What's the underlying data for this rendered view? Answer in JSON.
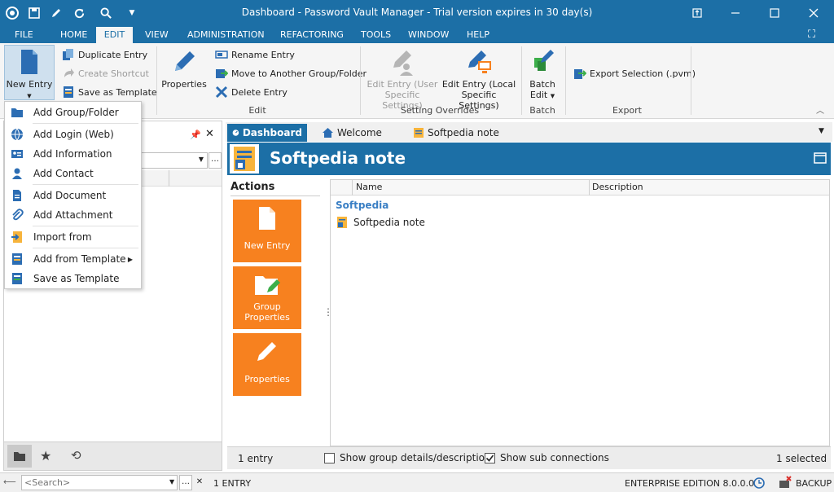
{
  "titlebar": {
    "title": "Dashboard - Password Vault Manager - Trial version expires in 30 day(s)"
  },
  "menu_tabs": [
    "FILE",
    "HOME",
    "EDIT",
    "VIEW",
    "ADMINISTRATION",
    "REFACTORING",
    "TOOLS",
    "WINDOW",
    "HELP"
  ],
  "ribbon": {
    "new_entry": "New Entry",
    "duplicate_entry": "Duplicate Entry",
    "create_shortcut": "Create Shortcut",
    "save_as_template": "Save as Template",
    "properties": "Properties",
    "rename_entry": "Rename Entry",
    "move_to_group": "Move to Another Group/Folder",
    "delete_entry": "Delete Entry",
    "edit_group": "Edit",
    "edit_entry_user_1": "Edit Entry (User",
    "edit_entry_user_2": "Specific Settings)",
    "edit_entry_local_1": "Edit Entry (Local",
    "edit_entry_local_2": "Specific Settings)",
    "setting_overrides_group": "Setting Overrides",
    "batch_edit_1": "Batch",
    "batch_edit_2": "Edit",
    "batch_group": "Batch",
    "export_selection": "Export Selection (.pvm)",
    "export_group": "Export"
  },
  "dropdown": {
    "items": [
      "Add Group/Folder",
      "Add Login (Web)",
      "Add Information",
      "Add Contact",
      "Add Document",
      "Add Attachment",
      "Import from",
      "Add from Template",
      "Save as Template"
    ]
  },
  "doc_tabs": [
    "Dashboard",
    "Welcome",
    "Softpedia note"
  ],
  "header": {
    "title": "Softpedia note"
  },
  "actions": {
    "title": "Actions",
    "new_entry": "New Entry",
    "group_properties_1": "Group",
    "group_properties_2": "Properties",
    "properties": "Properties"
  },
  "grid": {
    "columns": [
      "Name",
      "Description"
    ],
    "group": "Softpedia",
    "rows": [
      {
        "name": "Softpedia note",
        "description": ""
      }
    ]
  },
  "status": {
    "entry_count": "1 entry",
    "show_group_details": "Show group details/description",
    "show_group_details_checked": false,
    "show_sub_connections": "Show sub connections",
    "show_sub_connections_checked": true,
    "selected": "1 selected"
  },
  "bottom": {
    "search_placeholder": "<Search>",
    "entries": "1 ENTRY",
    "edition": "ENTERPRISE EDITION 8.0.0.0",
    "backup": "BACKUP"
  },
  "colors": {
    "accent_blue": "#1c6fa6",
    "tile_orange": "#f7811f",
    "group_blue": "#3a7fc4"
  }
}
